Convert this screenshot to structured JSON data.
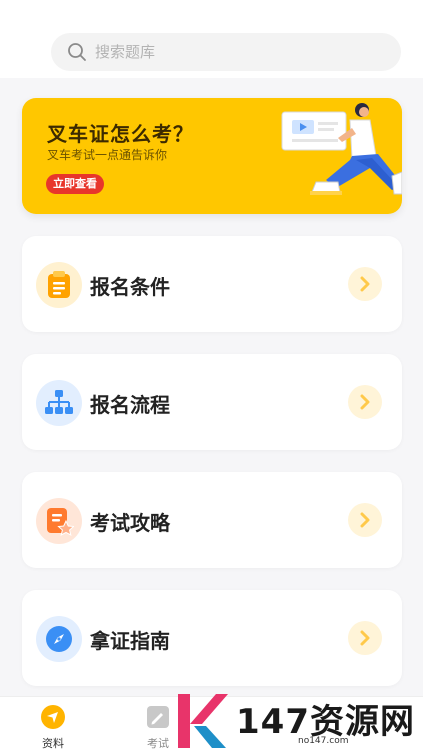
{
  "search": {
    "placeholder": "搜索题库"
  },
  "banner": {
    "title": "叉车证怎么考？",
    "subtitle": "叉车考试一点通告诉你",
    "cta_label": "立即查看",
    "color": "#ffc700"
  },
  "cards": [
    {
      "label": "报名条件",
      "icon": "clipboard-icon",
      "color": "#ffa200"
    },
    {
      "label": "报名流程",
      "icon": "flowchart-icon",
      "color": "#3a8ff5"
    },
    {
      "label": "考试攻略",
      "icon": "strategy-doc-icon",
      "color": "#ff7a2e"
    },
    {
      "label": "拿证指南",
      "icon": "compass-icon",
      "color": "#3a8ff5"
    }
  ],
  "tabbar": {
    "tabs": [
      {
        "label": "资料",
        "icon": "location-arrow-icon",
        "active": true
      },
      {
        "label": "考试",
        "icon": "exam-icon",
        "active": false
      }
    ]
  },
  "watermark": {
    "text": "147资源网",
    "domain": "no147.com"
  }
}
